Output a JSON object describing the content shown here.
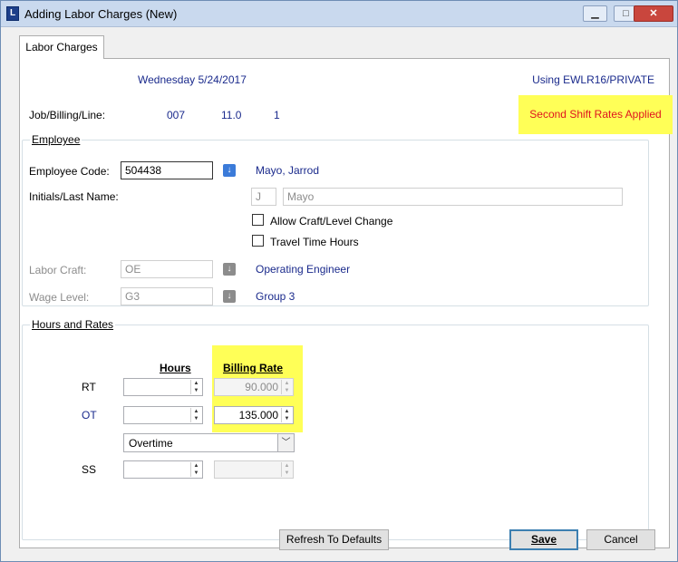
{
  "window": {
    "title": "Adding Labor Charges  (New)",
    "icon_letter": "L",
    "minimize_glyph": "▁",
    "maximize_glyph": "□",
    "close_glyph": "✕"
  },
  "tab": {
    "label": "Labor Charges"
  },
  "header": {
    "date": "Wednesday  5/24/2017",
    "using": "Using EWLR16/PRIVATE"
  },
  "job": {
    "label": "Job/Billing/Line:",
    "job": "007",
    "billing": "11.0",
    "line": "1"
  },
  "banner": {
    "text": "Second Shift Rates Applied",
    "color": "#e0141e",
    "background": "#ffff57"
  },
  "employee": {
    "group_title": "Employee",
    "code_label": "Employee Code:",
    "code_value": "504438",
    "employee_name": "Mayo, Jarrod",
    "initials_label": "Initials/Last Name:",
    "initials_value": "J",
    "last_name_value": "Mayo",
    "allow_change_label": "Allow Craft/Level Change",
    "travel_label": "Travel Time Hours",
    "craft_label": "Labor Craft:",
    "craft_value": "OE",
    "craft_name": "Operating Engineer",
    "wage_label": "Wage Level:",
    "wage_value": "G3",
    "wage_name": "Group 3"
  },
  "hours": {
    "group_title": "Hours and Rates",
    "hours_header": "Hours",
    "rate_header": "Billing Rate",
    "rows": [
      {
        "label": "RT",
        "hours": "",
        "rate": "90.000"
      },
      {
        "label": "OT",
        "hours": "",
        "rate": "135.000"
      },
      {
        "label": "SS",
        "hours": "",
        "rate": ""
      }
    ],
    "ot_type": "Overtime"
  },
  "buttons": {
    "refresh": "Refresh To Defaults",
    "save": "Save",
    "cancel": "Cancel"
  },
  "icons": {
    "lookup": "↓",
    "dropdown": "﹀",
    "spin_up": "▲",
    "spin_down": "▼"
  },
  "colors": {
    "accent_text": "#1a2a8c",
    "highlight": "#ffff57",
    "lookup_icon": "#3b7bd9"
  }
}
